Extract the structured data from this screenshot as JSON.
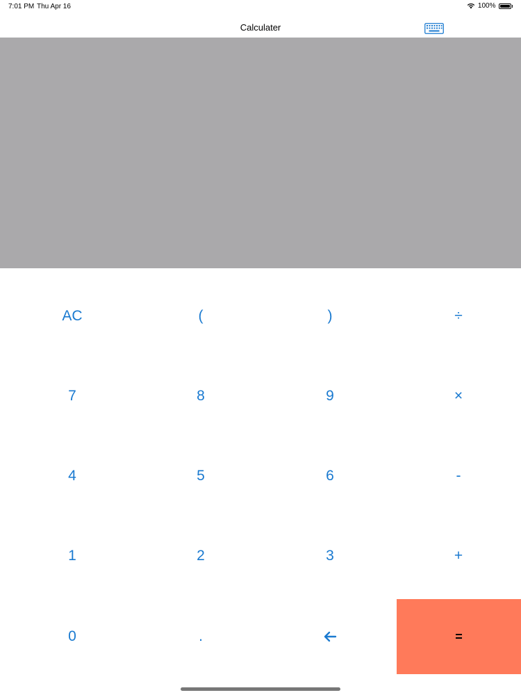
{
  "status_bar": {
    "time": "7:01 PM",
    "date": "Thu Apr 16",
    "battery": "100%"
  },
  "nav": {
    "title": "Calculater",
    "keyboard_icon": "keyboard-icon"
  },
  "display": {
    "value": ""
  },
  "keys": {
    "ac": "AC",
    "lparen": "(",
    "rparen": ")",
    "divide": "÷",
    "seven": "7",
    "eight": "8",
    "nine": "9",
    "multiply": "×",
    "four": "4",
    "five": "5",
    "six": "6",
    "minus": "-",
    "one": "1",
    "two": "2",
    "three": "3",
    "plus": "+",
    "zero": "0",
    "dot": ".",
    "backspace": "🡐",
    "equals": "="
  },
  "colors": {
    "accent": "#1a7ad0",
    "equals_bg": "#ff7a5a",
    "display_bg": "#aaa9ab"
  }
}
